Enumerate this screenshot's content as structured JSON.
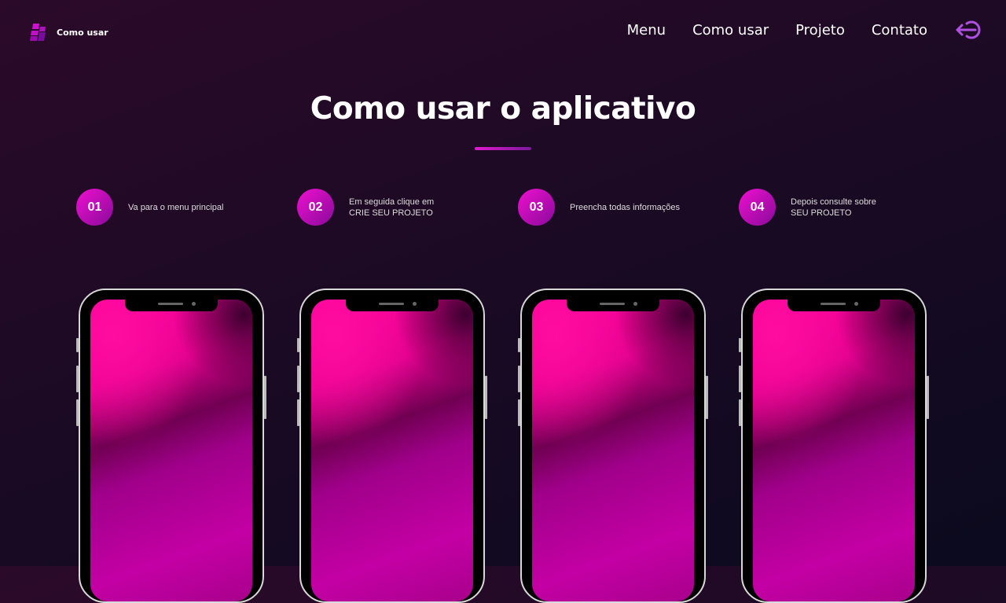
{
  "header": {
    "logo_text": "Como usar",
    "nav": [
      "Menu",
      "Como usar",
      "Projeto",
      "Contato"
    ],
    "exit_icon": "logout-icon"
  },
  "main": {
    "title": "Como usar o aplicativo",
    "steps": [
      {
        "number": "01",
        "text": "Va para o menu principal"
      },
      {
        "number": "02",
        "text": "Em seguida clique em\nCRIE SEU PROJETO"
      },
      {
        "number": "03",
        "text": "Preencha todas informações"
      },
      {
        "number": "04",
        "text": "Depois consulte sobre\nSEU PROJETO"
      }
    ]
  },
  "colors": {
    "accent": "#c010c0",
    "exit": "#b050e0"
  }
}
